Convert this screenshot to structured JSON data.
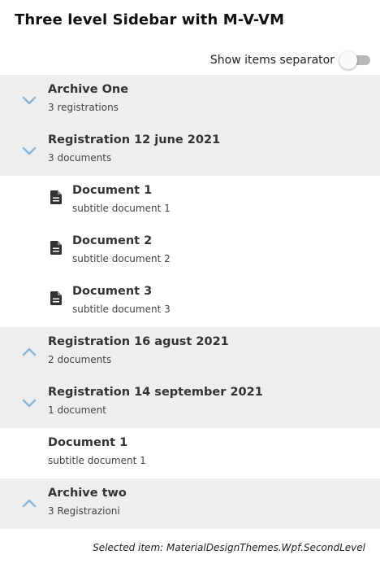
{
  "window": {
    "title": "Three level Sidebar with M-V-VM"
  },
  "toggle": {
    "label": "Show items separator",
    "checked": false
  },
  "colors": {
    "chevron": "#8fb6d3",
    "shaded_row": "#eeeeee",
    "doc_icon": "#333333"
  },
  "tree": {
    "archive_one": {
      "title": "Archive One",
      "subtitle": "3 registrations",
      "state": "expanded",
      "icon": "chevron-down-icon"
    },
    "reg_12_june": {
      "title": "Registration 12 june 2021",
      "subtitle": "3 documents",
      "state": "expanded",
      "icon": "chevron-down-icon",
      "documents": [
        {
          "title": "Document 1",
          "subtitle": "subtitle document 1",
          "icon": "document-icon"
        },
        {
          "title": "Document 2",
          "subtitle": "subtitle document 2",
          "icon": "document-icon"
        },
        {
          "title": "Document 3",
          "subtitle": "subtitle document 3",
          "icon": "document-icon"
        }
      ]
    },
    "reg_16_agust": {
      "title": "Registration 16 agust 2021",
      "subtitle": "2 documents",
      "state": "collapsed",
      "icon": "chevron-up-icon"
    },
    "reg_14_september": {
      "title": "Registration 14 september 2021",
      "subtitle": "1 document",
      "state": "expanded",
      "icon": "chevron-down-icon",
      "documents": [
        {
          "title": "Document 1",
          "subtitle": "subtitle document 1"
        }
      ]
    },
    "archive_two": {
      "title": "Archive two",
      "subtitle": "3 Registrazioni",
      "state": "collapsed",
      "icon": "chevron-up-icon"
    }
  },
  "status": {
    "selected_text": "Selected item: MaterialDesignThemes.Wpf.SecondLevel"
  }
}
